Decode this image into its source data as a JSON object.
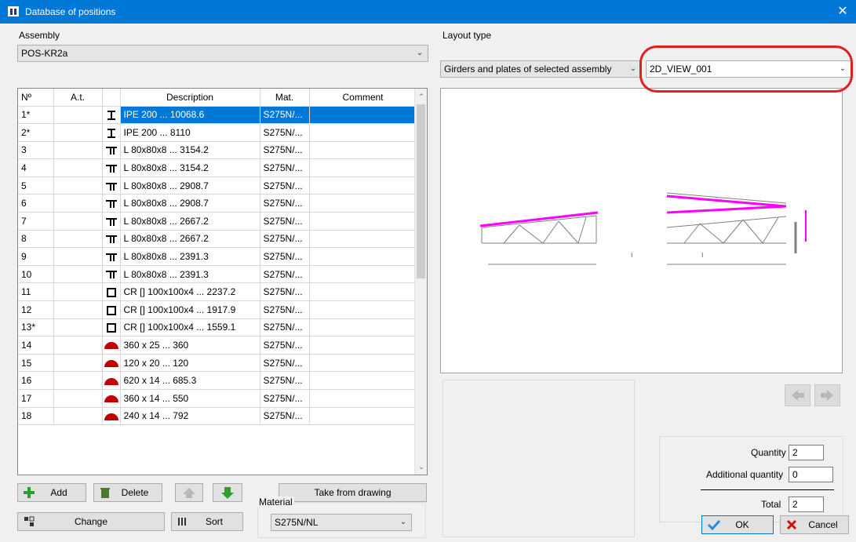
{
  "window": {
    "title": "Database of positions",
    "close_glyph": "✕"
  },
  "assembly": {
    "label": "Assembly",
    "value": "POS-KR2a"
  },
  "layout": {
    "label": "Layout type",
    "type_value": "Girders and plates of selected assembly",
    "view_value": "2D_VIEW_001"
  },
  "table": {
    "columns": [
      "Nº",
      "A.t.",
      "",
      "Description",
      "Mat.",
      "Comment"
    ],
    "rows": [
      {
        "no": "1*",
        "at": "",
        "icon": "i-beam",
        "desc": "IPE 200 ... 10068.6",
        "mat": "S275N/...",
        "comment": ""
      },
      {
        "no": "2*",
        "at": "",
        "icon": "i-beam",
        "desc": "IPE 200 ... 8110",
        "mat": "S275N/...",
        "comment": ""
      },
      {
        "no": "3",
        "at": "",
        "icon": "double-angle",
        "desc": "L 80x80x8 ... 3154.2",
        "mat": "S275N/...",
        "comment": ""
      },
      {
        "no": "4",
        "at": "",
        "icon": "double-angle",
        "desc": "L 80x80x8 ... 3154.2",
        "mat": "S275N/...",
        "comment": ""
      },
      {
        "no": "5",
        "at": "",
        "icon": "double-angle",
        "desc": "L 80x80x8 ... 2908.7",
        "mat": "S275N/...",
        "comment": ""
      },
      {
        "no": "6",
        "at": "",
        "icon": "double-angle",
        "desc": "L 80x80x8 ... 2908.7",
        "mat": "S275N/...",
        "comment": ""
      },
      {
        "no": "7",
        "at": "",
        "icon": "double-angle",
        "desc": "L 80x80x8 ... 2667.2",
        "mat": "S275N/...",
        "comment": ""
      },
      {
        "no": "8",
        "at": "",
        "icon": "double-angle",
        "desc": "L 80x80x8 ... 2667.2",
        "mat": "S275N/...",
        "comment": ""
      },
      {
        "no": "9",
        "at": "",
        "icon": "double-angle",
        "desc": "L 80x80x8 ... 2391.3",
        "mat": "S275N/...",
        "comment": ""
      },
      {
        "no": "10",
        "at": "",
        "icon": "double-angle",
        "desc": "L 80x80x8 ... 2391.3",
        "mat": "S275N/...",
        "comment": ""
      },
      {
        "no": "11",
        "at": "",
        "icon": "square-tube",
        "desc": "CR [] 100x100x4 ... 2237.2",
        "mat": "S275N/...",
        "comment": ""
      },
      {
        "no": "12",
        "at": "",
        "icon": "square-tube",
        "desc": "CR [] 100x100x4 ... 1917.9",
        "mat": "S275N/...",
        "comment": ""
      },
      {
        "no": "13*",
        "at": "",
        "icon": "square-tube",
        "desc": "CR [] 100x100x4 ... 1559.1",
        "mat": "S275N/...",
        "comment": ""
      },
      {
        "no": "14",
        "at": "",
        "icon": "plate",
        "desc": "360 x 25 ... 360",
        "mat": "S275N/...",
        "comment": ""
      },
      {
        "no": "15",
        "at": "",
        "icon": "plate",
        "desc": "120 x 20 ... 120",
        "mat": "S275N/...",
        "comment": ""
      },
      {
        "no": "16",
        "at": "",
        "icon": "plate",
        "desc": "620 x 14 ... 685.3",
        "mat": "S275N/...",
        "comment": ""
      },
      {
        "no": "17",
        "at": "",
        "icon": "plate",
        "desc": "360 x 14 ... 550",
        "mat": "S275N/...",
        "comment": ""
      },
      {
        "no": "18",
        "at": "",
        "icon": "plate",
        "desc": "240 x 14 ... 792",
        "mat": "S275N/...",
        "comment": ""
      }
    ]
  },
  "buttons": {
    "add": "Add",
    "delete": "Delete",
    "take_from_drawing": "Take from drawing",
    "change": "Change",
    "sort": "Sort",
    "ok": "OK",
    "cancel": "Cancel"
  },
  "material": {
    "label": "Material",
    "value": "S275N/NL"
  },
  "quantity": {
    "quantity_label": "Quantity",
    "quantity_value": "2",
    "additional_label": "Additional quantity",
    "additional_value": "0",
    "total_label": "Total",
    "total_value": "2"
  },
  "colors": {
    "title_bar": "#0078d7",
    "selection": "#0078d7",
    "highlight_oval": "#e02020",
    "drawing_top_chord": "#ff00ff"
  }
}
